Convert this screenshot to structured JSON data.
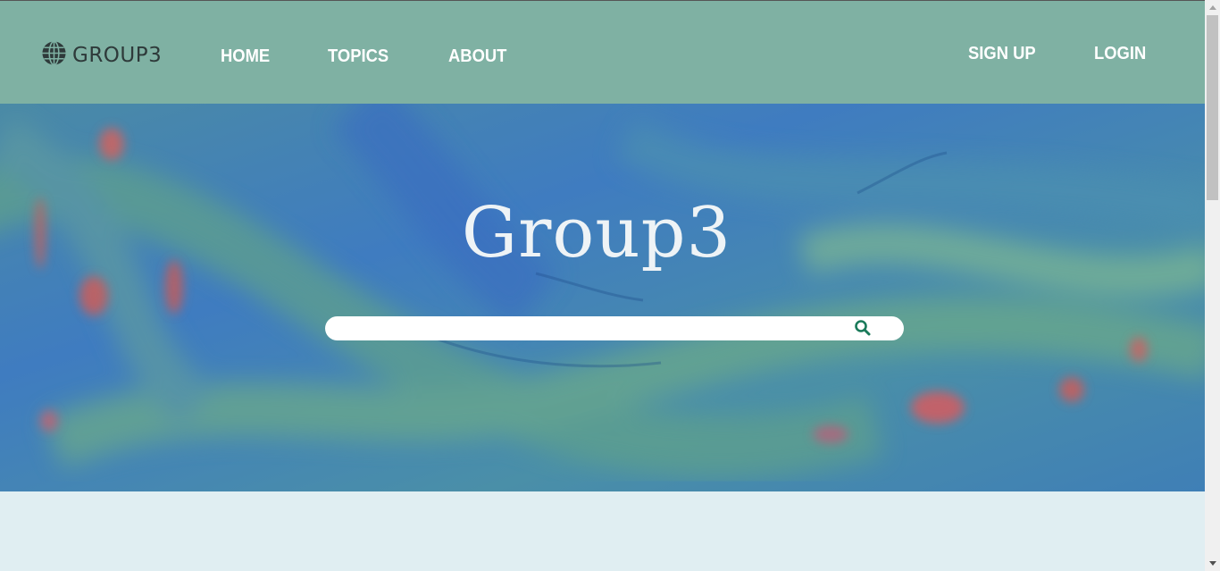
{
  "navbar": {
    "brand": {
      "icon": "globe-icon",
      "name": "GROUP3"
    },
    "left_links": [
      "HOME",
      "TOPICS",
      "ABOUT"
    ],
    "right_links": [
      "SIGN UP",
      "LOGIN"
    ],
    "background_color": "#7fb1a3"
  },
  "hero": {
    "title": "Group3",
    "search": {
      "value": "",
      "placeholder": "",
      "icon": "search-icon",
      "icon_color": "#1a7a5a"
    }
  },
  "colors": {
    "content_background": "#e0eef2"
  }
}
